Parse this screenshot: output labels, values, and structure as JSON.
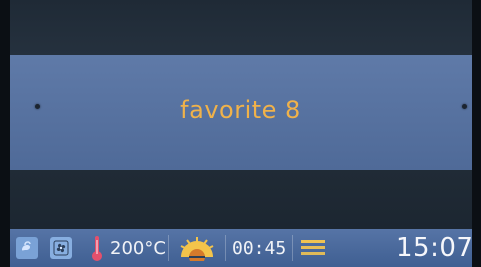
{
  "display": {
    "program_name": "favorite 8"
  },
  "status_bar": {
    "temperature": "200°C",
    "timer": "00:45",
    "clock": "15:07",
    "icons": [
      "steam-icon",
      "fan-icon",
      "thermometer-icon",
      "sun-heat-icon",
      "layers-icon"
    ]
  }
}
